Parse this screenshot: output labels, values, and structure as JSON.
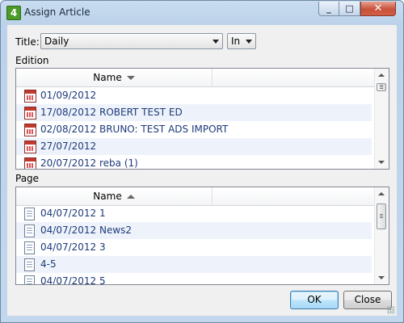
{
  "window": {
    "title": "Assign Article",
    "app_icon_text": "4"
  },
  "title_row": {
    "label": "Title:",
    "title_value": "Daily",
    "scope_value": "In"
  },
  "edition": {
    "label": "Edition",
    "column_header": "Name",
    "sort": "descending",
    "items": [
      {
        "label": "01/09/2012"
      },
      {
        "label": "17/08/2012 ROBERT TEST ED"
      },
      {
        "label": "02/08/2012 BRUNO: TEST ADS IMPORT"
      },
      {
        "label": "27/07/2012"
      },
      {
        "label": "20/07/2012 reba (1)"
      }
    ]
  },
  "page": {
    "label": "Page",
    "column_header": "Name",
    "sort": "ascending",
    "items": [
      {
        "label": "04/07/2012 1"
      },
      {
        "label": "04/07/2012 News2"
      },
      {
        "label": "04/07/2012 3"
      },
      {
        "label": "4-5"
      },
      {
        "label": "04/07/2012 5"
      }
    ]
  },
  "buttons": {
    "ok": "OK",
    "close": "Close"
  }
}
